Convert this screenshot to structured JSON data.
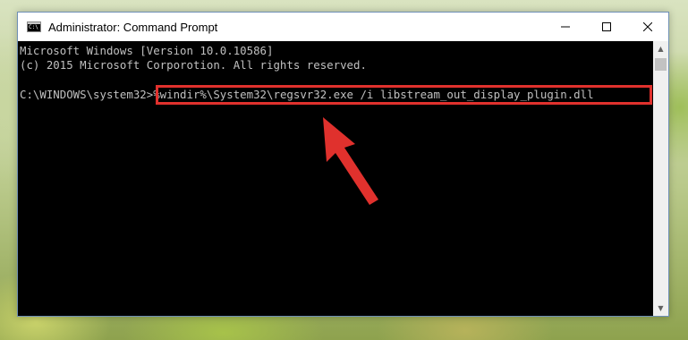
{
  "window": {
    "title": "Administrator: Command Prompt",
    "controls": {
      "minimize": "—",
      "maximize": "☐",
      "close": "✕"
    }
  },
  "console": {
    "lines": [
      "Microsoft Windows [Version 10.0.10586]",
      "(c) 2015 Microsoft Corporotion. All rights reserved."
    ],
    "prompt": "C:\\WINDOWS\\system32>",
    "command": "%windir%\\System32\\regsvr32.exe /i libstream_out_display_plugin.dll"
  },
  "annotation": {
    "highlight_color": "#e0312d"
  },
  "scrollbar": {
    "up_icon": "▲",
    "down_icon": "▼"
  }
}
